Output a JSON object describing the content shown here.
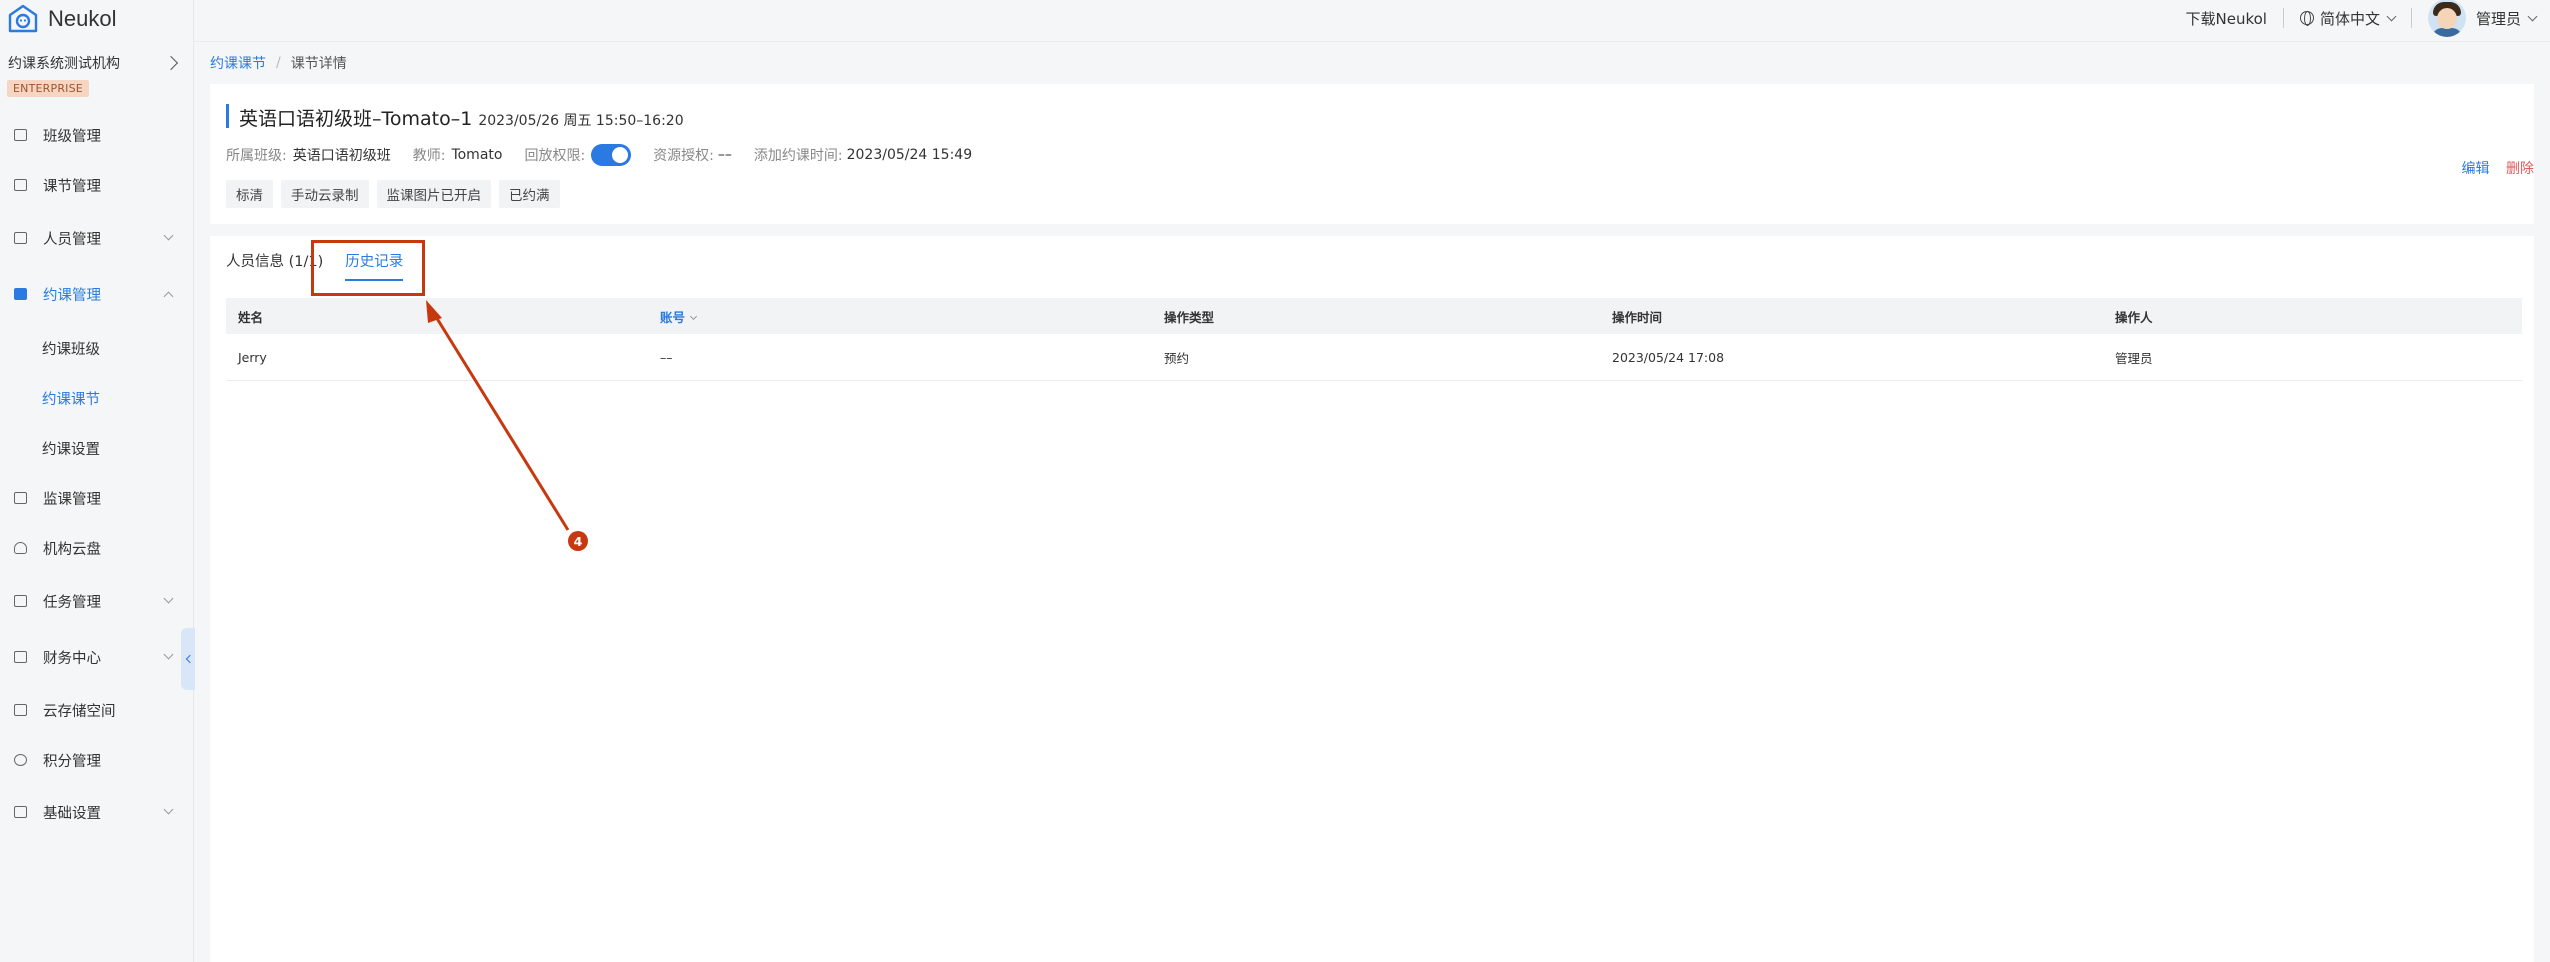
{
  "brand": {
    "name": "Neukol"
  },
  "sidebar": {
    "org_name": "约课系统测试机构",
    "edition_badge": "ENTERPRISE",
    "items": [
      {
        "label": "班级管理",
        "icon": "class-icon"
      },
      {
        "label": "课节管理",
        "icon": "lesson-icon"
      },
      {
        "label": "人员管理",
        "icon": "people-icon",
        "expandable": true
      },
      {
        "label": "约课管理",
        "icon": "booking-icon",
        "expandable": true,
        "expanded": true,
        "active": true
      },
      {
        "label": "监课管理",
        "icon": "monitor-icon"
      },
      {
        "label": "机构云盘",
        "icon": "cloud-icon"
      },
      {
        "label": "任务管理",
        "icon": "task-icon",
        "expandable": true
      },
      {
        "label": "财务中心",
        "icon": "finance-icon",
        "expandable": true
      },
      {
        "label": "云存储空间",
        "icon": "storage-icon"
      },
      {
        "label": "积分管理",
        "icon": "points-icon"
      },
      {
        "label": "基础设置",
        "icon": "settings-icon",
        "expandable": true
      }
    ],
    "sub_items": [
      {
        "label": "约课班级"
      },
      {
        "label": "约课课节",
        "active": true
      },
      {
        "label": "约课设置"
      }
    ]
  },
  "topbar": {
    "download_label": "下载Neukol",
    "language_label": "简体中文",
    "user_label": "管理员"
  },
  "breadcrumb": {
    "parent": "约课课节",
    "separator": "/",
    "current": "课节详情"
  },
  "lesson": {
    "title": "英语口语初级班–Tomato–1",
    "time": "2023/05/26 周五 15:50–16:20",
    "class_key": "所属班级:",
    "class_value": "英语口语初级班",
    "teacher_key": "教师:",
    "teacher_value": "Tomato",
    "playback_key": "回放权限:",
    "playback_enabled": true,
    "resource_key": "资源授权:",
    "resource_value": "––",
    "added_key": "添加约课时间:",
    "added_value": "2023/05/24 15:49",
    "tags": [
      "标清",
      "手动云录制",
      "监课图片已开启",
      "已约满"
    ],
    "edit_label": "编辑",
    "delete_label": "删除"
  },
  "tabs": [
    {
      "label": "人员信息 (1/1)"
    },
    {
      "label": "历史记录",
      "active": true
    }
  ],
  "table": {
    "headers": [
      "姓名",
      "账号",
      "操作类型",
      "操作时间",
      "操作人"
    ],
    "rows": [
      [
        "Jerry",
        "––",
        "预约",
        "2023/05/24 17:08",
        "管理员"
      ]
    ]
  },
  "annotation": {
    "number": "4",
    "color": "#c8380f"
  },
  "colors": {
    "accent": "#2a7ae2",
    "danger": "#e05a5a",
    "annotation": "#c8380f"
  }
}
